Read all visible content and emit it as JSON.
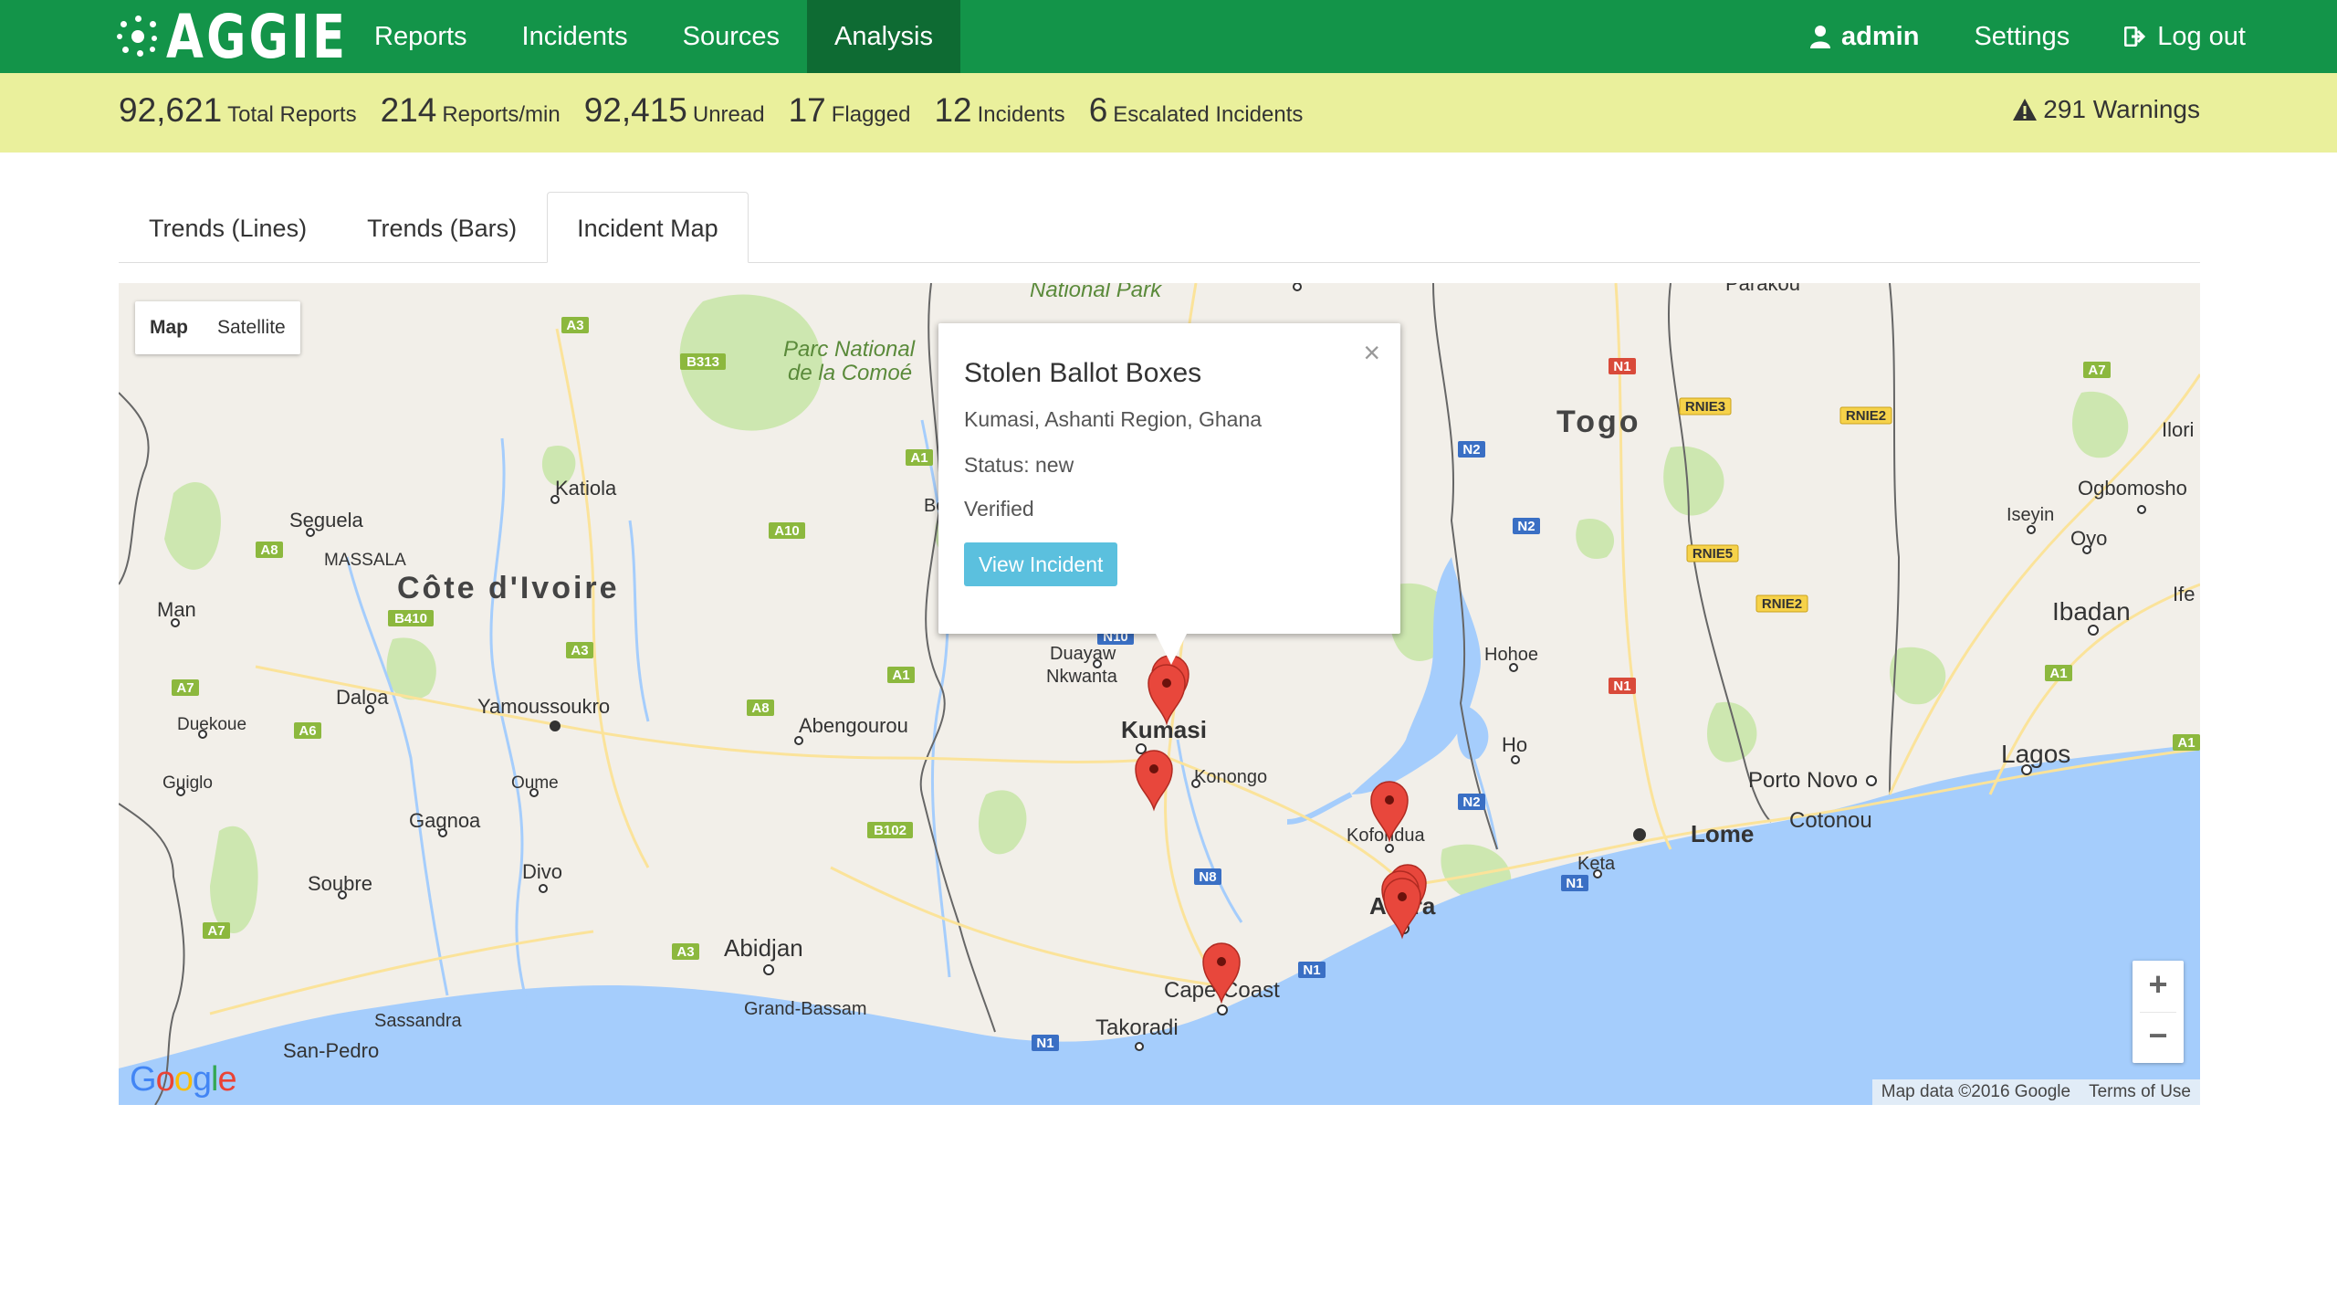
{
  "nav": {
    "brand": "AGGIE",
    "items": [
      "Reports",
      "Incidents",
      "Sources",
      "Analysis"
    ],
    "active": "Analysis",
    "user": "admin",
    "settings": "Settings",
    "logout": "Log out"
  },
  "stats": [
    {
      "num": "92,621",
      "label": "Total Reports"
    },
    {
      "num": "214",
      "label": "Reports/min"
    },
    {
      "num": "92,415",
      "label": "Unread"
    },
    {
      "num": "17",
      "label": "Flagged"
    },
    {
      "num": "12",
      "label": "Incidents"
    },
    {
      "num": "6",
      "label": "Escalated Incidents"
    }
  ],
  "warnings": "291 Warnings",
  "tabs": [
    "Trends (Lines)",
    "Trends (Bars)",
    "Incident Map"
  ],
  "active_tab": "Incident Map",
  "map": {
    "type_map": "Map",
    "type_satellite": "Satellite",
    "zoom_in": "+",
    "zoom_out": "−",
    "attribution": "Map data ©2016 Google",
    "terms": "Terms of Use",
    "logo": "Google",
    "labels": {
      "cote": "Côte d'Ivoire",
      "togo": "Togo",
      "parc1": "Parc National",
      "parc2": "de la Comoé",
      "natpark": "National Park",
      "parakou": "Parakou",
      "katiola": "Katiola",
      "seguela": "Seguela",
      "massala": "MASSALA",
      "man": "Man",
      "daloa": "Daloa",
      "yamoussoukro": "Yamoussoukro",
      "duekoue": "Duekoue",
      "guiglo": "Guiglo",
      "oume": "Oume",
      "gagnoa": "Gagnoa",
      "divo": "Divo",
      "soubre": "Soubre",
      "abidjan": "Abidjan",
      "grandbassam": "Grand-Bassam",
      "sassandra": "Sassandra",
      "sanpedro": "San-Pedro",
      "abengourou": "Abengourou",
      "duayaw": "Duayaw",
      "nkwanta": "Nkwanta",
      "kumasi": "Kumasi",
      "konongo": "Konongo",
      "koforidua": "Koforidua",
      "accra": "Accra",
      "capecoast": "Cape Coast",
      "takoradi": "Takoradi",
      "hohoe": "Hohoe",
      "ho": "Ho",
      "keta": "Keta",
      "lome": "Lome",
      "portonovo": "Porto Novo",
      "cotonou": "Cotonou",
      "lagos": "Lagos",
      "ibadan": "Ibadan",
      "ilori": "Ilori",
      "ogbomosho": "Ogbomosho",
      "iseyin": "Iseyin",
      "oyo": "Oyo",
      "ife": "Ife",
      "bo": "Bo"
    },
    "road_shields": [
      "A3",
      "B313",
      "A1",
      "A10",
      "A8",
      "B410",
      "A3",
      "A7",
      "A6",
      "A1",
      "A8",
      "B102",
      "A7",
      "A3",
      "N10",
      "N8",
      "N1",
      "N1",
      "N2",
      "N2",
      "N2",
      "N1",
      "N1",
      "N1",
      "RNIE3",
      "RNIE2",
      "RNIE5",
      "RNIE2",
      "A7",
      "A1",
      "A1"
    ]
  },
  "popup": {
    "title": "Stolen Ballot Boxes",
    "location": "Kumasi, Ashanti Region, Ghana",
    "status": "Status: new",
    "verified": "Verified",
    "button": "View Incident",
    "close": "×"
  }
}
